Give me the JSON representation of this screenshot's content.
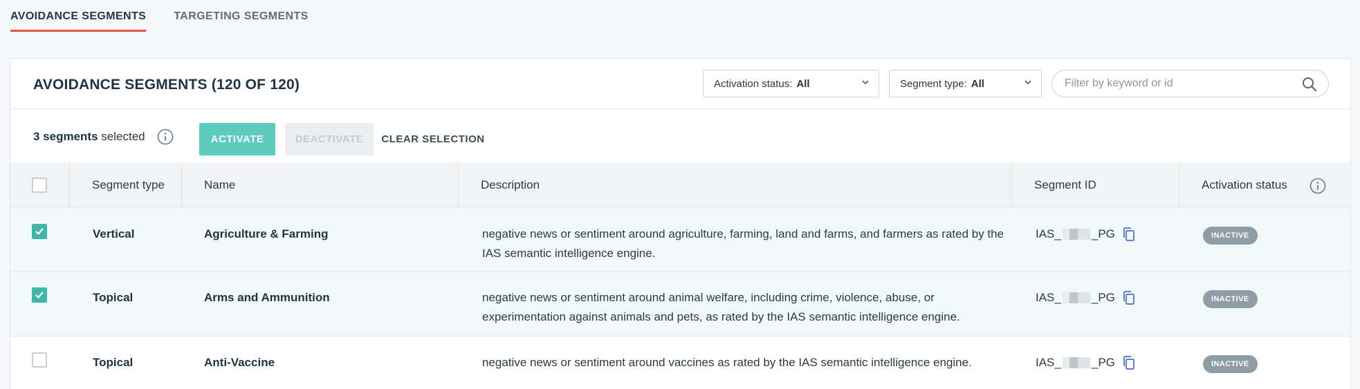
{
  "tabs": [
    {
      "label": "AVOIDANCE SEGMENTS",
      "active": true
    },
    {
      "label": "TARGETING SEGMENTS",
      "active": false
    }
  ],
  "panel": {
    "title": "AVOIDANCE SEGMENTS (120 OF 120)",
    "filters": {
      "activation_label": "Activation status:",
      "activation_value": "All",
      "type_label": "Segment type:",
      "type_value": "All"
    },
    "search": {
      "placeholder": "Filter by keyword or id"
    }
  },
  "selection": {
    "count": "3 segments",
    "suffix": "selected",
    "activate_label": "ACTIVATE",
    "deactivate_label": "DEACTIVATE",
    "clear_label": "CLEAR SELECTION"
  },
  "table": {
    "headers": {
      "type": "Segment type",
      "name": "Name",
      "description": "Description",
      "id": "Segment ID",
      "status": "Activation status"
    },
    "rows": [
      {
        "checked": true,
        "type": "Vertical",
        "name": "Agriculture & Farming",
        "description": "negative news or sentiment around agriculture, farming, land and farms, and farmers as rated by the IAS semantic intelligence engine.",
        "id_prefix": "IAS_",
        "id_suffix": "_PG",
        "status": "INACTIVE"
      },
      {
        "checked": true,
        "type": "Topical",
        "name": "Arms and Ammunition",
        "description": "negative news or sentiment around animal welfare, including crime, violence, abuse, or experimentation against animals and pets, as rated by the IAS semantic intelligence engine.",
        "id_prefix": "IAS_",
        "id_suffix": "_PG",
        "status": "INACTIVE"
      },
      {
        "checked": false,
        "type": "Topical",
        "name": "Anti-Vaccine",
        "description": "negative news or sentiment around vaccines as rated by the IAS semantic intelligence engine.",
        "id_prefix": "IAS_",
        "id_suffix": "_PG",
        "status": "INACTIVE"
      }
    ]
  },
  "colors": {
    "accent_tab": "#e8523c",
    "activate": "#5dccbf",
    "checkbox": "#3fb6a8",
    "badge": "#8d9ca5",
    "copy_icon": "#5b7fe0"
  }
}
